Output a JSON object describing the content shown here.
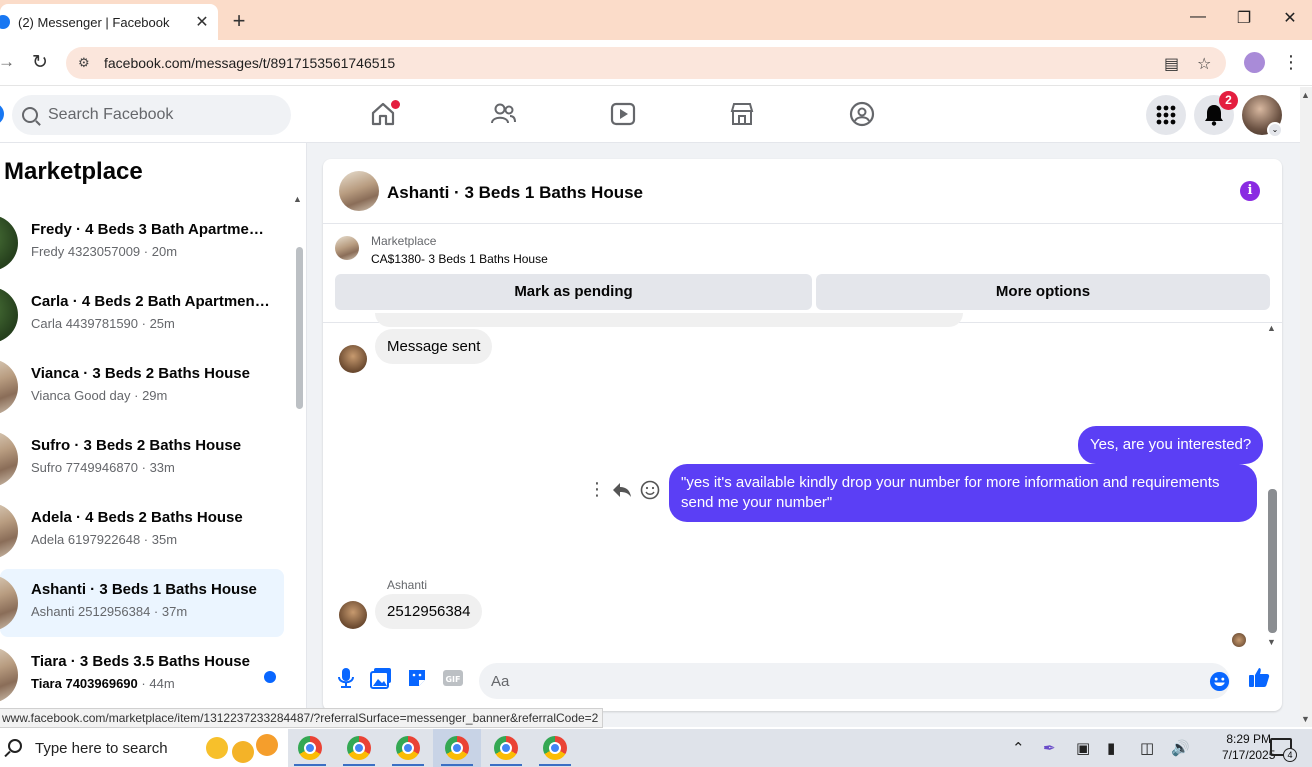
{
  "browser": {
    "tab_title": "(2) Messenger | Facebook",
    "tab_close": "✕",
    "new_tab": "+",
    "url": "facebook.com/messages/t/8917153561746515",
    "status_url": "www.facebook.com/marketplace/item/1312237233284487/?referralSurface=messenger_banner&referralCode=2"
  },
  "facebook": {
    "search_placeholder": "Search Facebook",
    "notification_count": "2"
  },
  "sidebar": {
    "title": "Marketplace",
    "conversations": [
      {
        "name": "Fredy · 4 Beds 3 Bath Apartment...",
        "sender": "Fredy",
        "preview": "4323057009",
        "time": "20m",
        "active": false,
        "unread": false
      },
      {
        "name": "Carla · 4 Beds 2 Bath Apartment...",
        "sender": "Carla",
        "preview": "4439781590",
        "time": "25m",
        "active": false,
        "unread": false
      },
      {
        "name": "Vianca · 3 Beds 2 Baths House",
        "sender": "Vianca",
        "preview": "Good day",
        "time": "29m",
        "active": false,
        "unread": false
      },
      {
        "name": "Sufro · 3 Beds 2 Baths House",
        "sender": "Sufro",
        "preview": "7749946870",
        "time": "33m",
        "active": false,
        "unread": false
      },
      {
        "name": "Adela · 4 Beds 2 Baths House",
        "sender": "Adela",
        "preview": "6197922648",
        "time": "35m",
        "active": false,
        "unread": false
      },
      {
        "name": "Ashanti · 3 Beds 1 Baths House",
        "sender": "Ashanti",
        "preview": "2512956384",
        "time": "37m",
        "active": true,
        "unread": false
      },
      {
        "name": "Tiara · 3 Beds 3.5 Baths House",
        "sender": "Tiara",
        "preview": "7403969690",
        "time": "44m",
        "active": false,
        "unread": true
      }
    ]
  },
  "chat": {
    "title": "Ashanti · 3 Beds 1 Baths House",
    "banner_label": "Marketplace",
    "banner_item": "CA$1380- 3 Beds 1 Baths House",
    "mark_pending": "Mark as pending",
    "more_options": "More options",
    "messages": {
      "system_sent": "Message sent",
      "out_1": "Yes, are you interested?",
      "out_2": "\"yes it's available kindly drop your number for more information and requirements send me your number\"",
      "in_sender": "Ashanti",
      "in_1": "2512956384"
    },
    "composer_placeholder": "Aa"
  },
  "taskbar": {
    "search_text": "Type here to search",
    "time": "8:29 PM",
    "date": "7/17/2025",
    "notification_count": "4"
  },
  "colors": {
    "accent_purple": "#5b3ff5",
    "fb_blue": "#0866ff",
    "active_conv_bg": "#ebf5ff",
    "tabstrip": "#fbdcc9"
  }
}
